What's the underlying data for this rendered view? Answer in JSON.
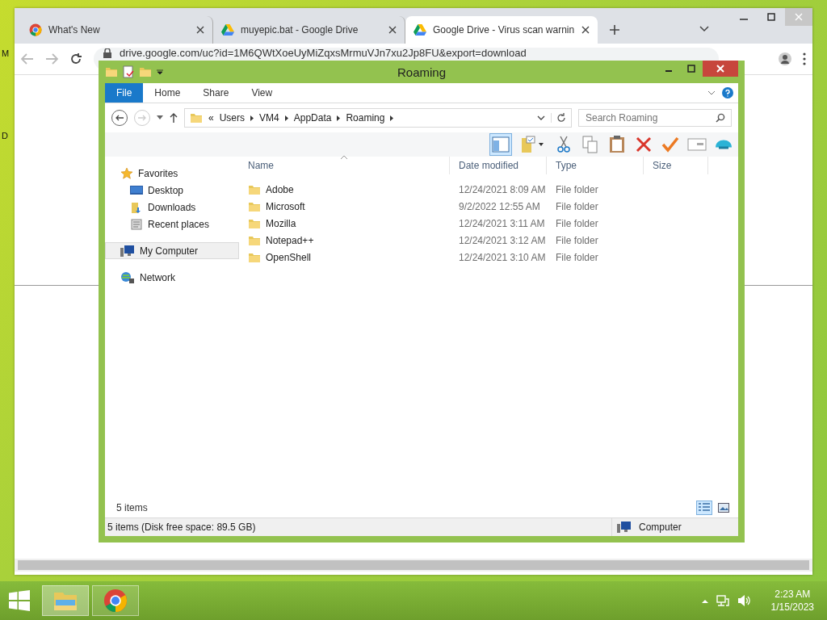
{
  "desktop": {
    "icon_labels": [
      "M",
      "D"
    ]
  },
  "browser": {
    "tabs": [
      {
        "title": "What's New",
        "kind": "chrome",
        "selected": false
      },
      {
        "title": "muyepic.bat - Google Drive",
        "kind": "drive",
        "selected": false
      },
      {
        "title": "Google Drive - Virus scan warnin",
        "kind": "drive",
        "selected": true
      }
    ],
    "url": "drive.google.com/uc?id=1M6QWtXoeUyMiZqxsMrmuVJn7xu2Jp8FU&export=download"
  },
  "explorer": {
    "title": "Roaming",
    "ribbon_tabs": [
      {
        "label": "File",
        "kind": "file"
      },
      {
        "label": "Home",
        "kind": "tab"
      },
      {
        "label": "Share",
        "kind": "tab"
      },
      {
        "label": "View",
        "kind": "tab"
      }
    ],
    "breadcrumb": {
      "overflow": "«",
      "parts": [
        "Users",
        "VM4",
        "AppData",
        "Roaming"
      ]
    },
    "search": {
      "placeholder": "Search Roaming"
    },
    "toolbar": [
      {
        "kind": "pane",
        "selected": true
      },
      {
        "kind": "folder-props",
        "selected": false
      },
      {
        "kind": "cut",
        "selected": false
      },
      {
        "kind": "copy",
        "selected": false
      },
      {
        "kind": "paste",
        "selected": false
      },
      {
        "kind": "delete",
        "selected": false
      },
      {
        "kind": "check",
        "selected": false
      },
      {
        "kind": "rename",
        "selected": false
      },
      {
        "kind": "shell",
        "selected": false
      }
    ],
    "nav": [
      {
        "label": "Favorites",
        "kind": "star",
        "selected": false,
        "children": [
          {
            "label": "Desktop",
            "kind": "desktop",
            "selected": false
          },
          {
            "label": "Downloads",
            "kind": "downloads",
            "selected": false
          },
          {
            "label": "Recent places",
            "kind": "recent",
            "selected": false
          }
        ]
      },
      {
        "label": "My Computer",
        "kind": "computer",
        "selected": true
      },
      {
        "label": "Network",
        "kind": "network",
        "selected": false
      }
    ],
    "columns": [
      "Name",
      "Date modified",
      "Type",
      "Size"
    ],
    "rows": [
      {
        "name": "Adobe",
        "date": "12/24/2021 8:09 AM",
        "type": "File folder"
      },
      {
        "name": "Microsoft",
        "date": "9/2/2022 12:55 AM",
        "type": "File folder"
      },
      {
        "name": "Mozilla",
        "date": "12/24/2021 3:11 AM",
        "type": "File folder"
      },
      {
        "name": "Notepad++",
        "date": "12/24/2021 3:12 AM",
        "type": "File folder"
      },
      {
        "name": "OpenShell",
        "date": "12/24/2021 3:10 AM",
        "type": "File folder"
      }
    ],
    "item_count": "5 items",
    "views": [
      {
        "kind": "details",
        "selected": true
      },
      {
        "kind": "large",
        "selected": false
      }
    ],
    "status": {
      "text": "5 items (Disk free space: 89.5 GB)",
      "location": "Computer"
    }
  },
  "taskbar": {
    "apps": [
      {
        "kind": "explorer",
        "selected": true
      },
      {
        "kind": "chrome",
        "selected": false
      }
    ],
    "time": "2:23 AM",
    "date": "1/15/2023"
  }
}
